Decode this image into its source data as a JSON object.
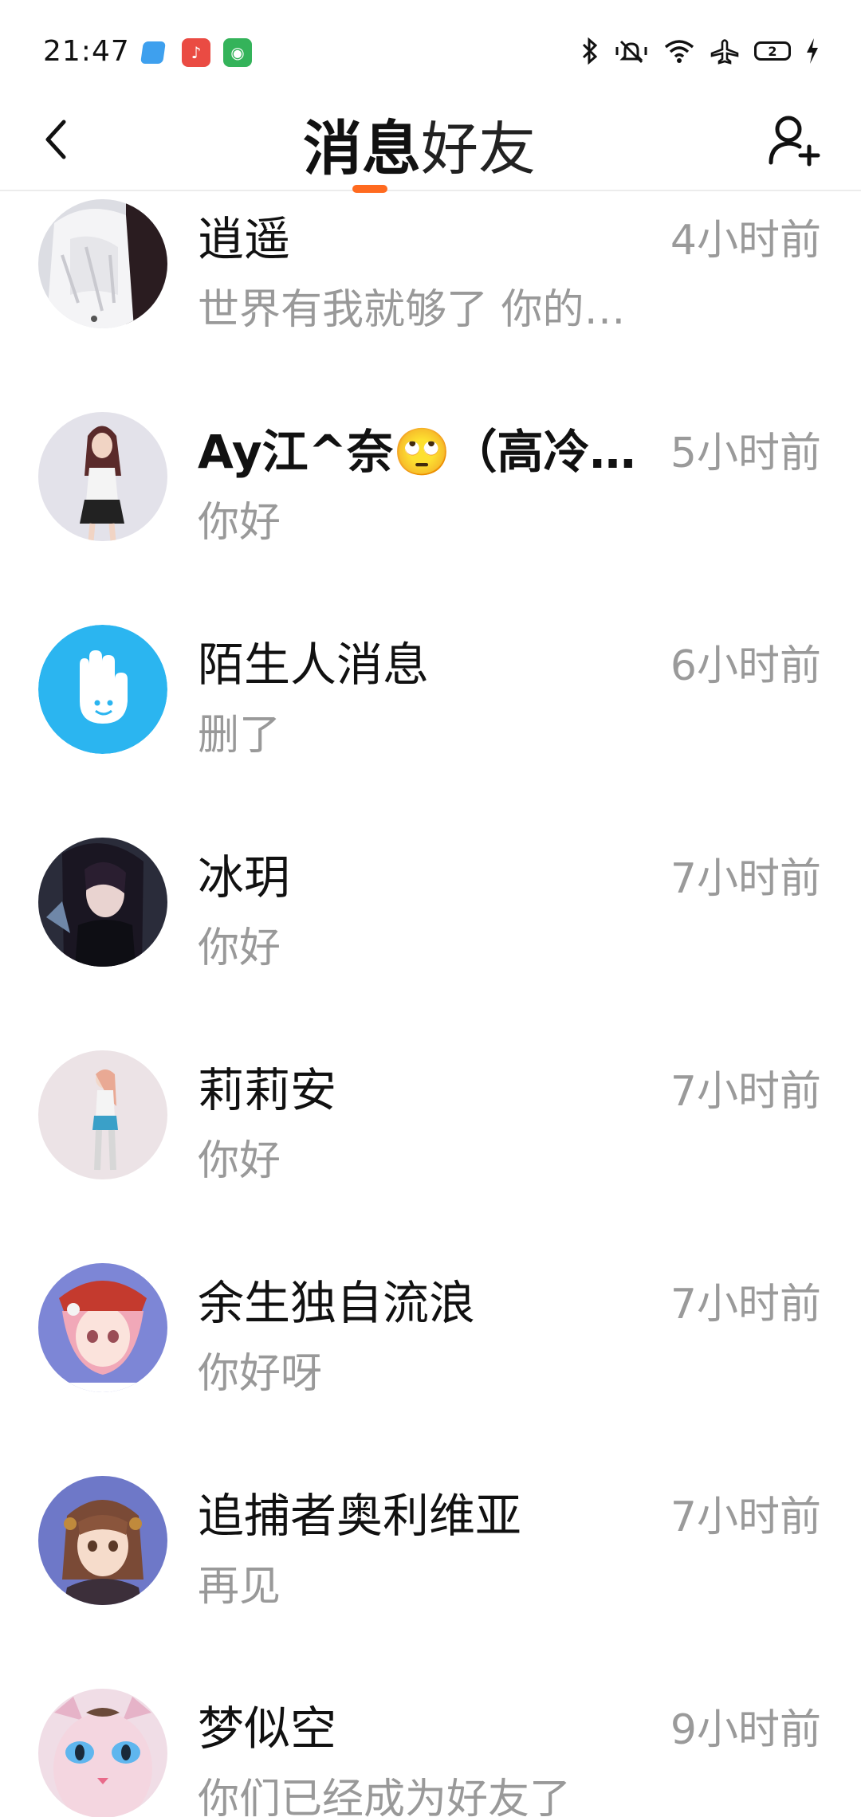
{
  "status_bar": {
    "time": "21:47",
    "battery": "2",
    "icons": [
      "bluetooth-icon",
      "mute-vibrate-icon",
      "wifi-icon",
      "airplane-mode-icon",
      "battery-icon",
      "charging-icon"
    ]
  },
  "header": {
    "tabs": [
      {
        "label": "消息",
        "active": true
      },
      {
        "label": "好友",
        "active": false
      }
    ],
    "accent_color": "#ff6a1f"
  },
  "conversations": [
    {
      "name": "逍遥",
      "time": "4小时前",
      "preview": "世界有我就够了 你的…"
    },
    {
      "name": "Ay江^奈🙄（高冷…",
      "time": "5小时前",
      "preview": "你好"
    },
    {
      "name": "陌生人消息",
      "time": "6小时前",
      "preview": "删了"
    },
    {
      "name": "冰玥",
      "time": "7小时前",
      "preview": "你好"
    },
    {
      "name": "莉莉安",
      "time": "7小时前",
      "preview": "你好"
    },
    {
      "name": "余生独自流浪",
      "time": "7小时前",
      "preview": "你好呀"
    },
    {
      "name": "追捕者奥利维亚",
      "time": "7小时前",
      "preview": "再见"
    },
    {
      "name": "梦似空",
      "time": "9小时前",
      "preview": "你们已经成为好友了"
    }
  ]
}
